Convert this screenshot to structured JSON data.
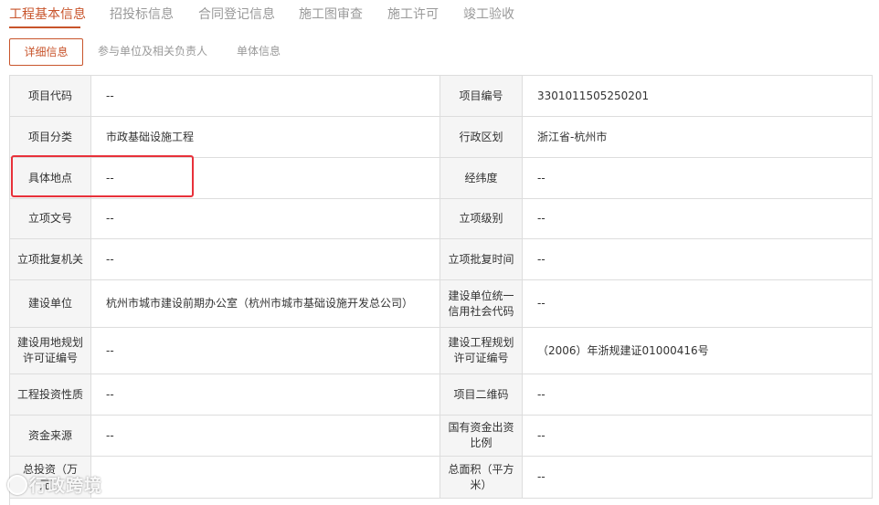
{
  "tabs": [
    {
      "label": "工程基本信息"
    },
    {
      "label": "招投标信息"
    },
    {
      "label": "合同登记信息"
    },
    {
      "label": "施工图审查"
    },
    {
      "label": "施工许可"
    },
    {
      "label": "竣工验收"
    }
  ],
  "subtabs": [
    {
      "label": "详细信息"
    },
    {
      "label": "参与单位及相关负责人"
    },
    {
      "label": "单体信息"
    }
  ],
  "rows": [
    {
      "l1": "项目代码",
      "v1": "--",
      "l2": "项目编号",
      "v2": "3301011505250201"
    },
    {
      "l1": "项目分类",
      "v1": "市政基础设施工程",
      "l2": "行政区划",
      "v2": "浙江省-杭州市"
    },
    {
      "l1": "具体地点",
      "v1": "--",
      "l2": "经纬度",
      "v2": "--"
    },
    {
      "l1": "立项文号",
      "v1": "--",
      "l2": "立项级别",
      "v2": "--"
    },
    {
      "l1": "立项批复机关",
      "v1": "--",
      "l2": "立项批复时间",
      "v2": "--"
    },
    {
      "l1": "建设单位",
      "v1": "杭州市城市建设前期办公室（杭州市城市基础设施开发总公司）",
      "l2": "建设单位统一信用社会代码",
      "v2": "--"
    },
    {
      "l1": "建设用地规划许可证编号",
      "v1": "--",
      "l2": "建设工程规划许可证编号",
      "v2": "（2006）年浙规建证01000416号"
    },
    {
      "l1": "工程投资性质",
      "v1": "--",
      "l2": "项目二维码",
      "v2": "--"
    },
    {
      "l1": "资金来源",
      "v1": "--",
      "l2": "国有资金出资比例",
      "v2": "--"
    },
    {
      "l1": "总投资（万元）",
      "v1": "",
      "l2": "总面积（平方米）",
      "v2": "--"
    }
  ],
  "watermark": {
    "text": "行政跨境"
  },
  "colors": {
    "accent": "#c8542b",
    "highlight": "#e8313a",
    "label_bg": "#f5f5f5",
    "border": "#dddddd"
  }
}
